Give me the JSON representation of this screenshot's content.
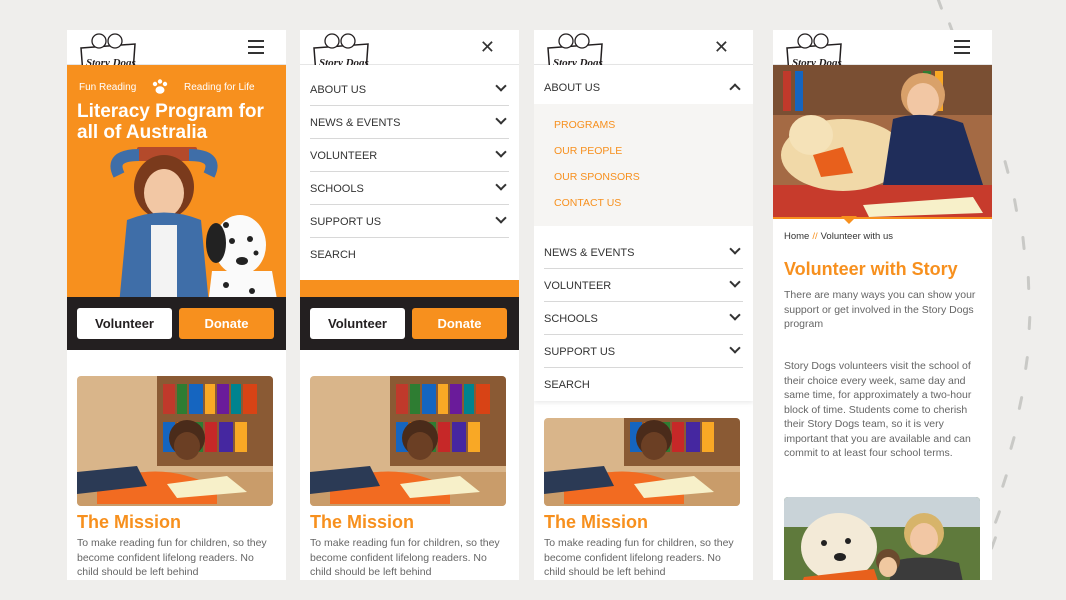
{
  "brand": {
    "logo_text": "Story Dogs",
    "orange": "#f7901e",
    "dark": "#231f20"
  },
  "hero": {
    "tag_left": "Fun Reading",
    "tag_right": "Reading for Life",
    "title": "Literacy Program for all of Australia"
  },
  "actions": {
    "volunteer": "Volunteer",
    "donate": "Donate"
  },
  "mission": {
    "title": "The Mission",
    "text": "To make reading fun for children, so they become confident lifelong readers. No child should be left behind"
  },
  "menu": {
    "items": [
      "ABOUT US",
      "NEWS & EVENTS",
      "VOLUNTEER",
      "SCHOOLS",
      "SUPPORT US",
      "SEARCH"
    ],
    "about_sub": [
      "PROGRAMS",
      "OUR PEOPLE",
      "OUR SPONSORS",
      "CONTACT US"
    ]
  },
  "volunteer_page": {
    "breadcrumb_home": "Home",
    "breadcrumb_sep": "//",
    "breadcrumb_current": "Volunteer with us",
    "title": "Volunteer with Story",
    "intro": "There are many ways you can show your support or get involved in the Story Dogs program",
    "body": "Story Dogs volunteers visit the school of their choice every week, same day and same time, for approximately a two-hour block of time. Students come to cherish their Story Dogs team, so it is very important that you are available and can commit to at least four school terms."
  },
  "icons": [
    "logo-icon",
    "hamburger-icon",
    "close-icon",
    "chevron-down-icon",
    "chevron-up-icon",
    "paw-icon"
  ]
}
